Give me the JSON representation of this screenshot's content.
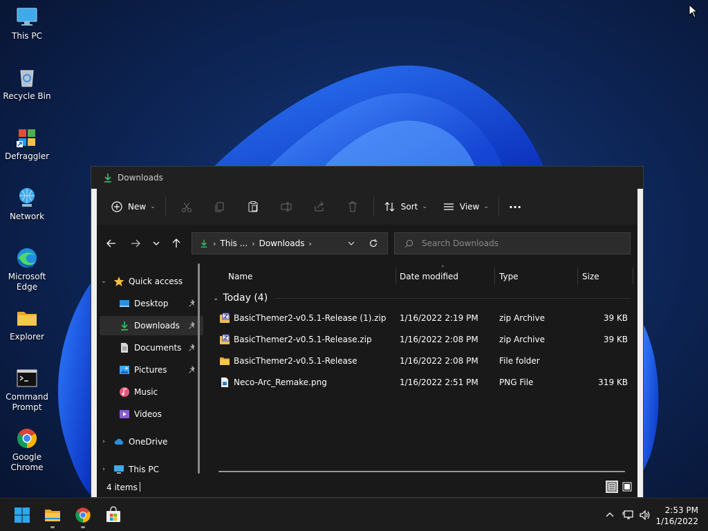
{
  "desktop": {
    "icons": [
      {
        "label": "This PC",
        "icon": "monitor-icon"
      },
      {
        "label": "Recycle Bin",
        "icon": "recycle-bin-icon"
      },
      {
        "label": "Defraggler",
        "icon": "defraggler-icon"
      },
      {
        "label": "Network",
        "icon": "network-icon"
      },
      {
        "label": "Microsoft Edge",
        "icon": "edge-icon"
      },
      {
        "label": "Explorer",
        "icon": "folder-icon"
      },
      {
        "label": "Command Prompt",
        "icon": "cmd-icon"
      },
      {
        "label": "Google Chrome",
        "icon": "chrome-icon"
      }
    ]
  },
  "window": {
    "title": "Downloads"
  },
  "commandbar": {
    "new_label": "New",
    "sort_label": "Sort",
    "view_label": "View",
    "more_label": "···"
  },
  "address": {
    "root": "This ...",
    "current": "Downloads"
  },
  "search": {
    "placeholder": "Search Downloads"
  },
  "nav": {
    "quick_access": "Quick access",
    "items": [
      {
        "label": "Desktop",
        "pinned": true
      },
      {
        "label": "Downloads",
        "pinned": true,
        "selected": true
      },
      {
        "label": "Documents",
        "pinned": true
      },
      {
        "label": "Pictures",
        "pinned": true
      },
      {
        "label": "Music",
        "pinned": false
      },
      {
        "label": "Videos",
        "pinned": false
      }
    ],
    "onedrive": "OneDrive",
    "thispc": "This PC"
  },
  "columns": {
    "name": "Name",
    "date": "Date modified",
    "type": "Type",
    "size": "Size"
  },
  "group": {
    "label": "Today (4)"
  },
  "files": [
    {
      "name": "BasicThemer2-v0.5.1-Release (1).zip",
      "date": "1/16/2022 2:19 PM",
      "type": "zip Archive",
      "size": "39 KB",
      "icon": "zip-icon"
    },
    {
      "name": "BasicThemer2-v0.5.1-Release.zip",
      "date": "1/16/2022 2:08 PM",
      "type": "zip Archive",
      "size": "39 KB",
      "icon": "zip-icon"
    },
    {
      "name": "BasicThemer2-v0.5.1-Release",
      "date": "1/16/2022 2:08 PM",
      "type": "File folder",
      "size": "",
      "icon": "folder-icon"
    },
    {
      "name": "Neco-Arc_Remake.png",
      "date": "1/16/2022 2:51 PM",
      "type": "PNG File",
      "size": "319 KB",
      "icon": "image-file-icon"
    }
  ],
  "status": {
    "count": "4 items"
  },
  "taskbar": {
    "time": "2:53 PM",
    "date": "1/16/2022"
  },
  "colors": {
    "accent": "#0078d4",
    "download_green": "#35c46a",
    "folder_yellow": "#f2c14e"
  }
}
